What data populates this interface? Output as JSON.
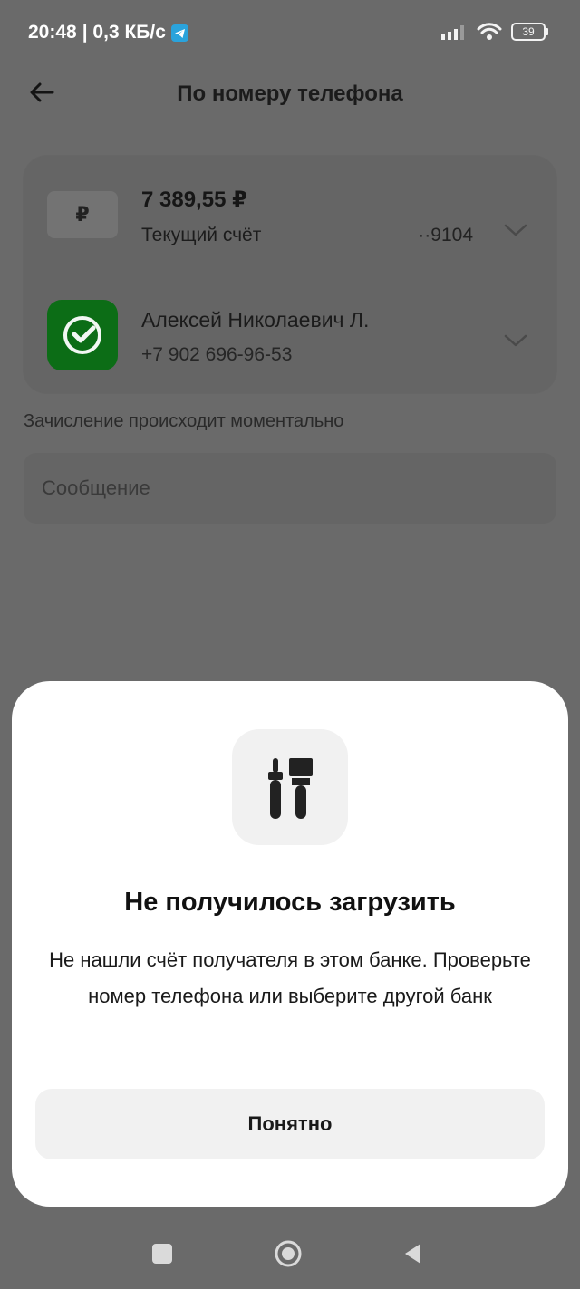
{
  "status_bar": {
    "time": "20:48",
    "network_speed": "| 0,3 КБ/с",
    "battery": "39",
    "icons": [
      "telegram-icon",
      "signal-icon",
      "wifi-icon",
      "battery-icon"
    ]
  },
  "header": {
    "title": "По номеру телефона",
    "back_icon": "arrow-left-icon"
  },
  "source_account": {
    "currency_icon": "₽",
    "amount": "7 389,55 ₽",
    "type": "Текущий счёт",
    "number": "··9104"
  },
  "recipient": {
    "bank_icon": "sber-logo-icon",
    "name": "Алексей Николаевич Л.",
    "phone": "+7 902 696-96-53"
  },
  "note": "Зачисление происходит моментально",
  "message": {
    "placeholder": "Сообщение"
  },
  "dialog": {
    "icon": "tools-icon",
    "title": "Не получилось загрузить",
    "text": "Не нашли счёт получателя в этом банке. Проверьте номер телефона или выберите другой банк",
    "button_label": "Понятно"
  },
  "navigation_bar": {
    "icons": [
      "recent-apps-icon",
      "home-icon",
      "back-icon"
    ]
  },
  "colors": {
    "overlay_background": "#6a6a6a",
    "sheet_background": "#ffffff",
    "button_background": "#f1f1f1",
    "sber_green": "#0c6d16"
  }
}
